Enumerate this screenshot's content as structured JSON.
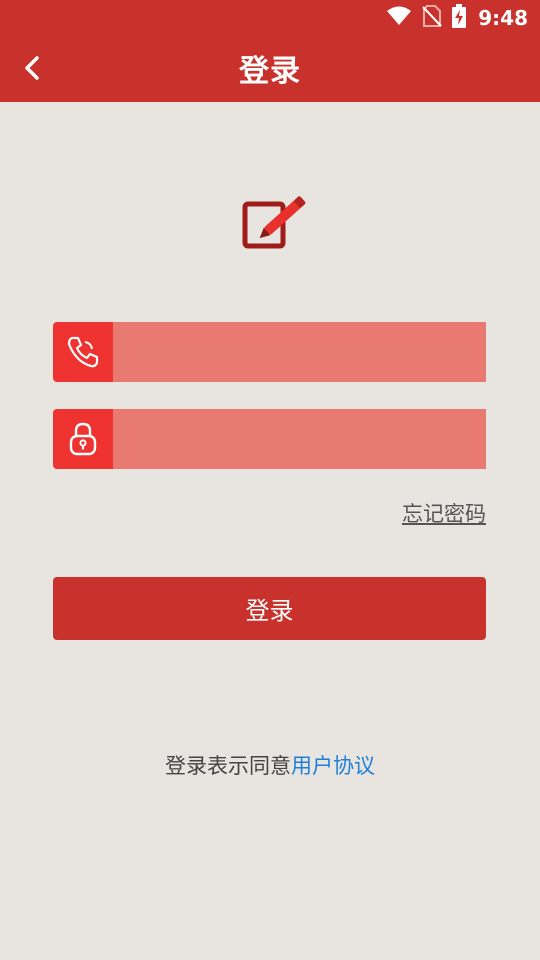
{
  "status_bar": {
    "time": "9:48",
    "icons": [
      "wifi-icon",
      "no-sim-icon",
      "battery-charging-icon"
    ]
  },
  "header": {
    "back_icon": "chevron-left-icon",
    "title": "登录"
  },
  "logo": {
    "icon": "edit-pencil-icon"
  },
  "form": {
    "phone": {
      "icon": "phone-icon",
      "value": "",
      "placeholder": ""
    },
    "password": {
      "icon": "lock-icon",
      "value": "",
      "placeholder": ""
    },
    "forgot_password_label": "忘记密码",
    "login_button_label": "登录"
  },
  "agreement": {
    "prefix": "登录表示同意",
    "link_text": "用户协议"
  },
  "colors": {
    "primary": "#c9322c",
    "icon_box": "#ee3330",
    "input_bg": "#e97a71",
    "background": "#e8e5e0",
    "link": "#1e7fd8"
  }
}
